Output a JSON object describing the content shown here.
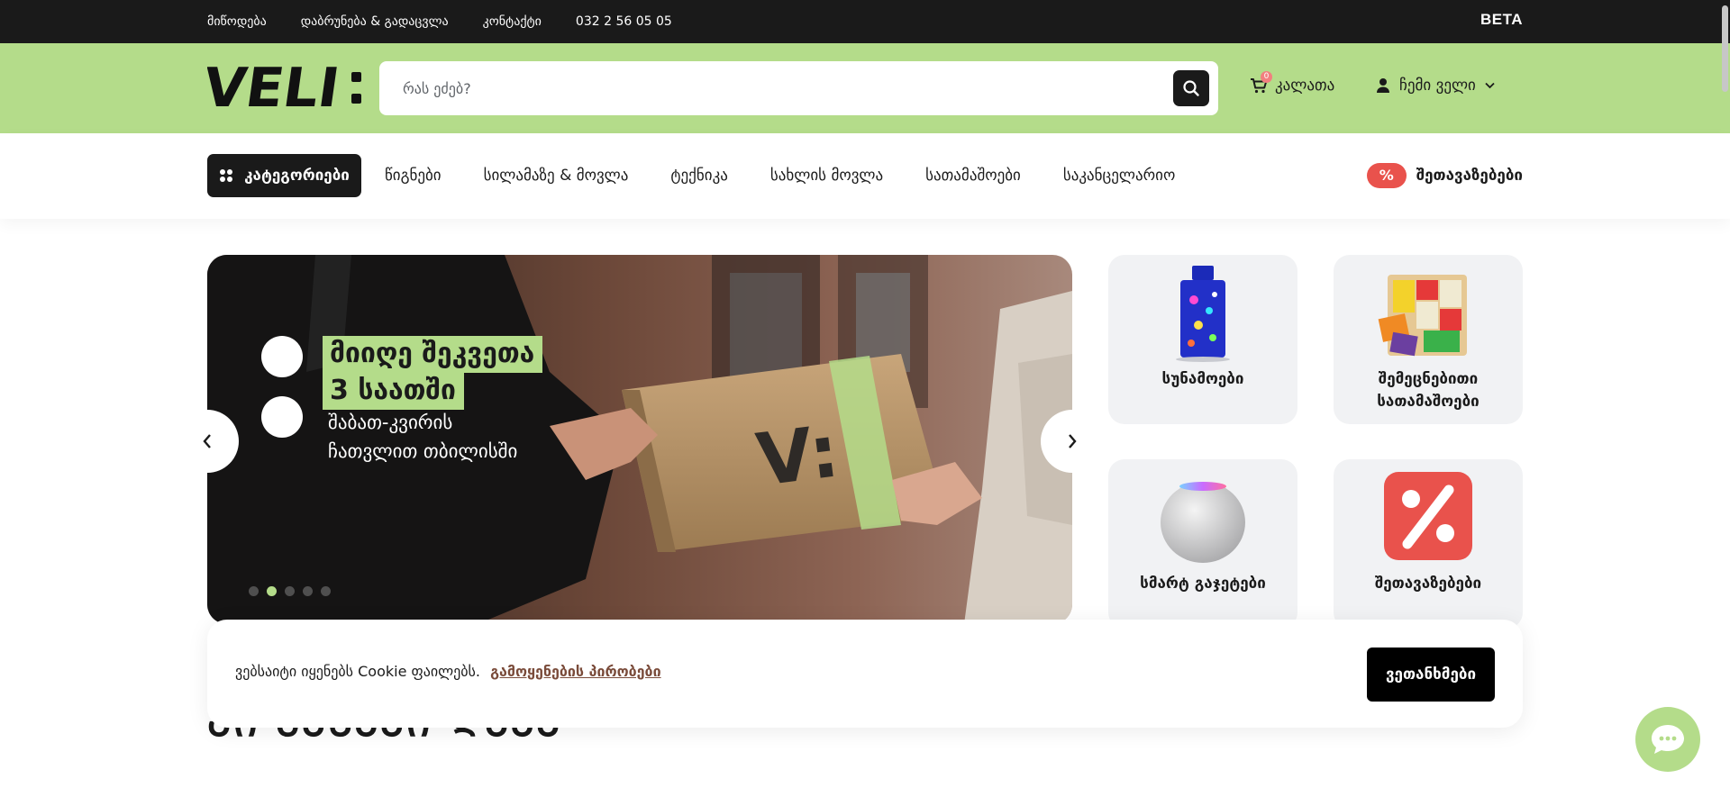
{
  "topbar": {
    "links": [
      "მიწოდება",
      "დაბრუნება & გადაცვლა",
      "კონტაქტი",
      "032 2 56 05 05"
    ],
    "beta_label": "BETA"
  },
  "header": {
    "logo_text": "VELI:",
    "search_placeholder": "რას ეძებ?",
    "cart_label": "კალათა",
    "cart_count": "0",
    "account_label": "ჩემი ველი"
  },
  "nav": {
    "categories_button": "კატეგორიები",
    "links": [
      "წიგნები",
      "სილამაზე & მოვლა",
      "ტექნიკა",
      "სახლის მოვლა",
      "სათამაშოები",
      "საკანცელარიო"
    ],
    "offers_badge": "%",
    "offers_label": "შეთავაზებები"
  },
  "hero": {
    "title_line_1": "მიიღე შეკვეთა",
    "title_line_2": "3 საათში",
    "subtitle_line_1": "შაბათ-კვირის",
    "subtitle_line_2": "ჩათვლით თბილისში",
    "box_logo": "V:",
    "slide_count": 5,
    "active_slide": 2
  },
  "tiles": [
    {
      "label": "სუნამოები",
      "icon": "perfume-bottle-icon"
    },
    {
      "label": "შემეცნებითი სათამაშოები",
      "icon": "wooden-puzzle-icon"
    },
    {
      "label": "სმარტ გაჯეტები",
      "icon": "smart-speaker-icon"
    },
    {
      "label": "შეთავაზებები",
      "icon": "percent-badge-icon"
    }
  ],
  "cookie": {
    "text": "ვებსაიტი იყენებს Cookie ფაილებს.",
    "link": "გამოყენების პირობები",
    "accept": "ვეთანხმები"
  },
  "section": {
    "title": "ᲐᲘ ᲛᲐᲡᲐᲐᲘ ᲓᲐᲐᲐ"
  },
  "colors": {
    "brand_green": "#b4dc8a",
    "dark": "#1a1a1a",
    "offer_red": "#e9524c"
  }
}
